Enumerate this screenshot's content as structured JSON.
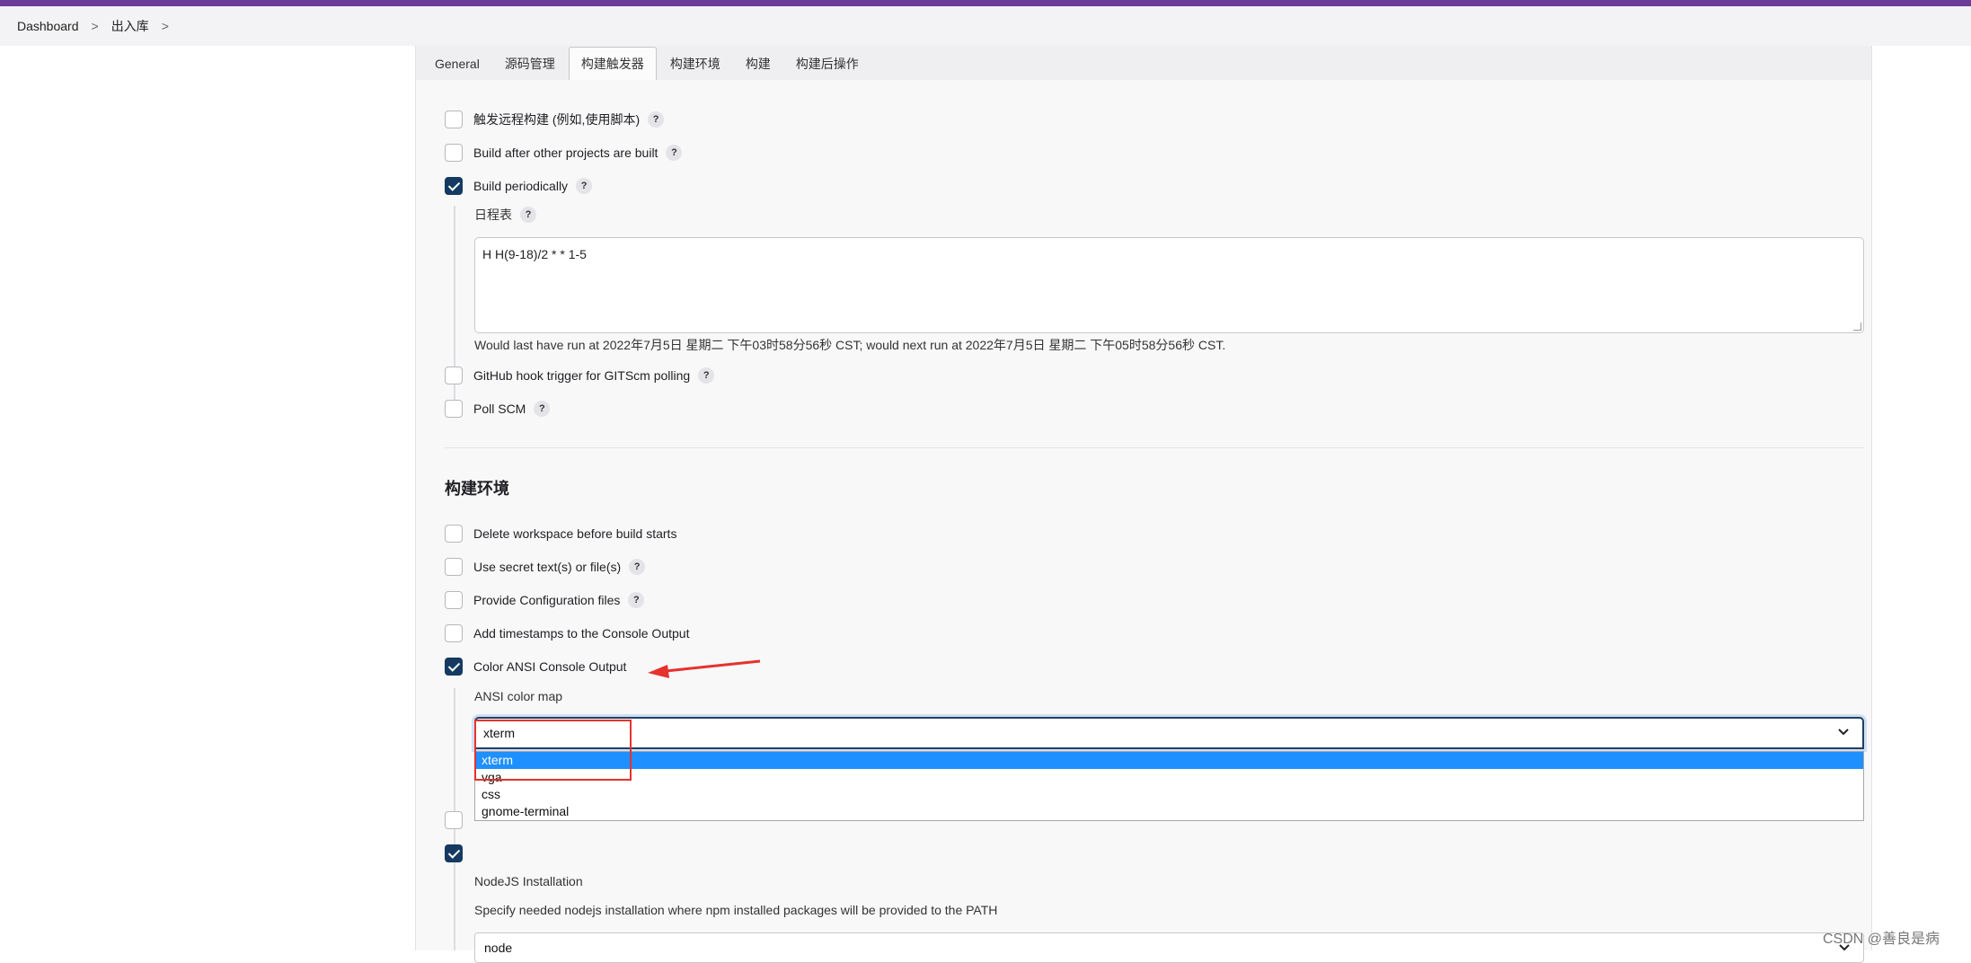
{
  "breadcrumb": {
    "item1": "Dashboard",
    "item2": "出入库",
    "sep": ">"
  },
  "tabs": [
    {
      "label": "General"
    },
    {
      "label": "源码管理"
    },
    {
      "label": "构建触发器"
    },
    {
      "label": "构建环境"
    },
    {
      "label": "构建"
    },
    {
      "label": "构建后操作"
    }
  ],
  "triggers": {
    "remote": "触发远程构建 (例如,使用脚本)",
    "after_other": "Build after other projects are built",
    "periodically": "Build periodically",
    "schedule_label": "日程表",
    "schedule_value": "H H(9-18)/2 * * 1-5",
    "schedule_info": "Would last have run at 2022年7月5日 星期二 下午03时58分56秒 CST; would next run at 2022年7月5日 星期二 下午05时58分56秒 CST.",
    "github_hook": "GitHub hook trigger for GITScm polling",
    "poll_scm": "Poll SCM"
  },
  "env": {
    "title": "构建环境",
    "delete_ws": "Delete workspace before build starts",
    "secret": "Use secret text(s) or file(s)",
    "config_files": "Provide Configuration files",
    "timestamps": "Add timestamps to the Console Output",
    "ansi": "Color ANSI Console Output",
    "ansi_label": "ANSI color map",
    "ansi_value": "xterm",
    "ansi_options": [
      "xterm",
      "vga",
      "css",
      "gnome-terminal"
    ],
    "nodejs_label": "NodeJS Installation",
    "nodejs_desc": "Specify needed nodejs installation where npm installed packages will be provided to the PATH",
    "nodejs_value": "node"
  },
  "help_glyph": "?",
  "watermark": "CSDN @善良是病",
  "colors": {
    "accent": "#143a61",
    "highlight": "#1e90ff",
    "annotation": "#e5322d",
    "topbar": "#6a3d9a"
  }
}
